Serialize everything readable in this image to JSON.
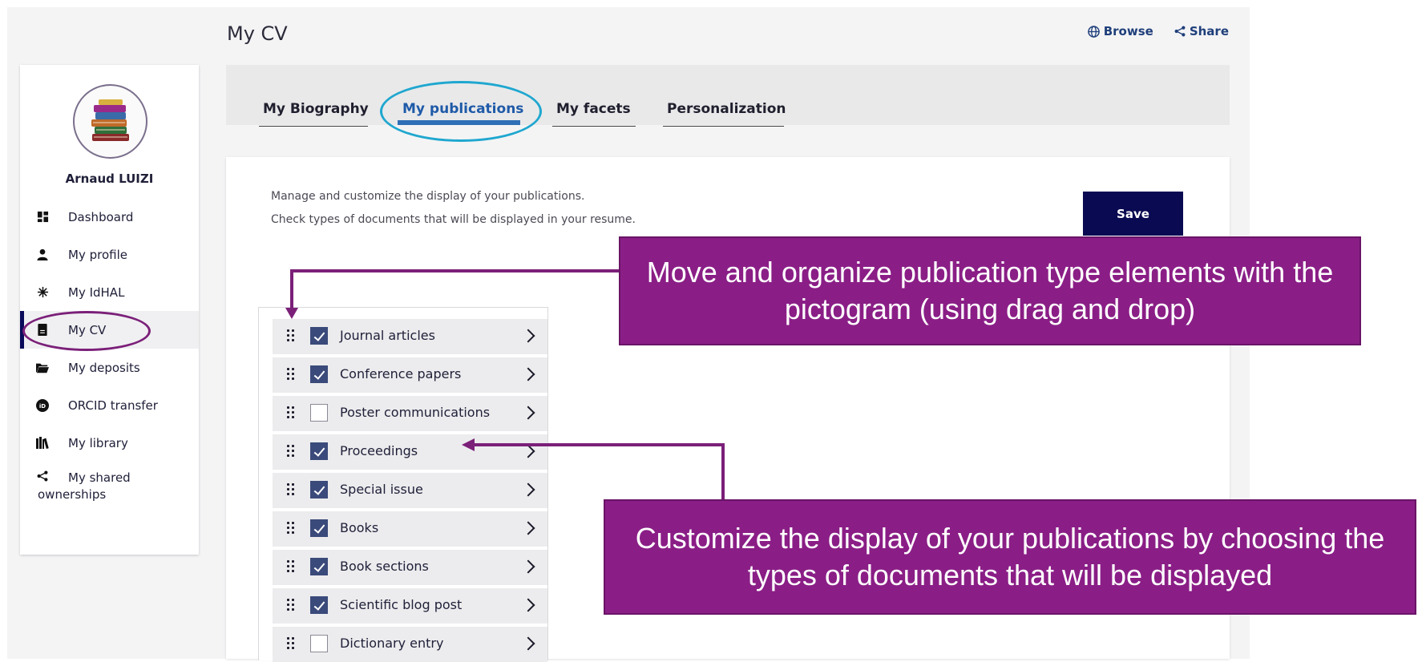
{
  "page": {
    "title": "My CV"
  },
  "top_actions": {
    "browse": "Browse",
    "share": "Share"
  },
  "user": {
    "name": "Arnaud LUIZI"
  },
  "sidebar": {
    "items": [
      {
        "label": "Dashboard",
        "icon": "dashboard-icon"
      },
      {
        "label": "My profile",
        "icon": "user-icon"
      },
      {
        "label": "My IdHAL",
        "icon": "idhal-icon"
      },
      {
        "label": "My CV",
        "icon": "cv-icon",
        "active": true
      },
      {
        "label": "My deposits",
        "icon": "folder-icon"
      },
      {
        "label": "ORCID transfer",
        "icon": "orcid-icon"
      },
      {
        "label": "My library",
        "icon": "library-icon"
      },
      {
        "label": "My shared ownerships",
        "icon": "share-icon"
      }
    ]
  },
  "tabs": [
    {
      "label": "My Biography"
    },
    {
      "label": "My publications",
      "active": true
    },
    {
      "label": "My facets"
    },
    {
      "label": "Personalization"
    }
  ],
  "main": {
    "description_1": "Manage and customize the display of your publications.",
    "description_2": "Check types of documents that will be displayed in your resume.",
    "save_label": "Save"
  },
  "doc_types": [
    {
      "label": "Journal articles",
      "checked": true
    },
    {
      "label": "Conference papers",
      "checked": true
    },
    {
      "label": "Poster communications",
      "checked": false
    },
    {
      "label": "Proceedings",
      "checked": true
    },
    {
      "label": "Special issue",
      "checked": true
    },
    {
      "label": "Books",
      "checked": true
    },
    {
      "label": "Book sections",
      "checked": true
    },
    {
      "label": "Scientific blog post",
      "checked": true
    },
    {
      "label": "Dictionary entry",
      "checked": false
    }
  ],
  "callouts": {
    "drag": "Move and organize publication type elements with the pictogram (using drag and drop)",
    "customize": "Customize the display of your publications by choosing the types of documents that will be displayed"
  },
  "colors": {
    "accent_purple": "#8a1e86",
    "tab_active_blue": "#2f6fb5",
    "save_navy": "#0a0a52",
    "highlight_cyan": "#1fa7cf"
  }
}
